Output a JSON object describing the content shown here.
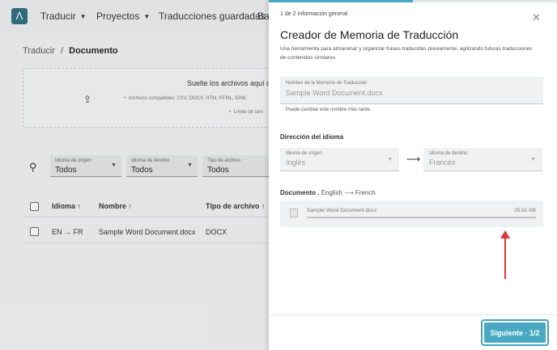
{
  "nav": {
    "logo": "Λ",
    "items": [
      "Traducir",
      "Proyectos",
      "Traducciones guardadas",
      "Ba"
    ]
  },
  "breadcrumb": {
    "parent": "Traducir",
    "sep": "/",
    "current": "Documento"
  },
  "dropzone": {
    "title": "Suelte los archivos aquí o h",
    "formats": "Archivos compatibles: CSV, DOCX, HTM, HTML, IDML",
    "limit": "Límite de tam"
  },
  "filters": [
    {
      "label": "Idioma de origen",
      "value": "Todos"
    },
    {
      "label": "Idioma de destino",
      "value": "Todos"
    },
    {
      "label": "Tipo de archivo",
      "value": "Todos"
    }
  ],
  "table": {
    "headers": [
      "Idioma",
      "Nombre",
      "Tipo de archivo"
    ],
    "row": {
      "source": "EN",
      "target": "FR",
      "name": "Sample Word Document.docx",
      "type": "DOCX"
    }
  },
  "modal": {
    "step": "1 de 2 Información general",
    "progress": 0.5,
    "title": "Creador de Memoria de Traducción",
    "description": "Una herramienta para almacenar y organizar frases traducidas previamente, agilizando futuras traducciones de contenidos similares.",
    "name_field": {
      "label": "Nombre de la Memoria de Traducción",
      "value": "Sample Word Document.docx"
    },
    "name_hint": "Puede cambiar este nombre más tarde.",
    "direction_title": "Dirección del idioma",
    "source_field": {
      "label": "Idioma de origen",
      "value": "Inglés"
    },
    "target_field": {
      "label": "Idioma de destino",
      "value": "Francés"
    },
    "document_label": "Documento .",
    "document_source": "English",
    "document_target": "French",
    "file": {
      "name": "Sample Word Document.docx",
      "size": "25.61 KB"
    },
    "next_button": "Siguiente · 1/2"
  },
  "colors": {
    "accent": "#4aa9c2",
    "annotation_arrow": "#e0343c"
  }
}
